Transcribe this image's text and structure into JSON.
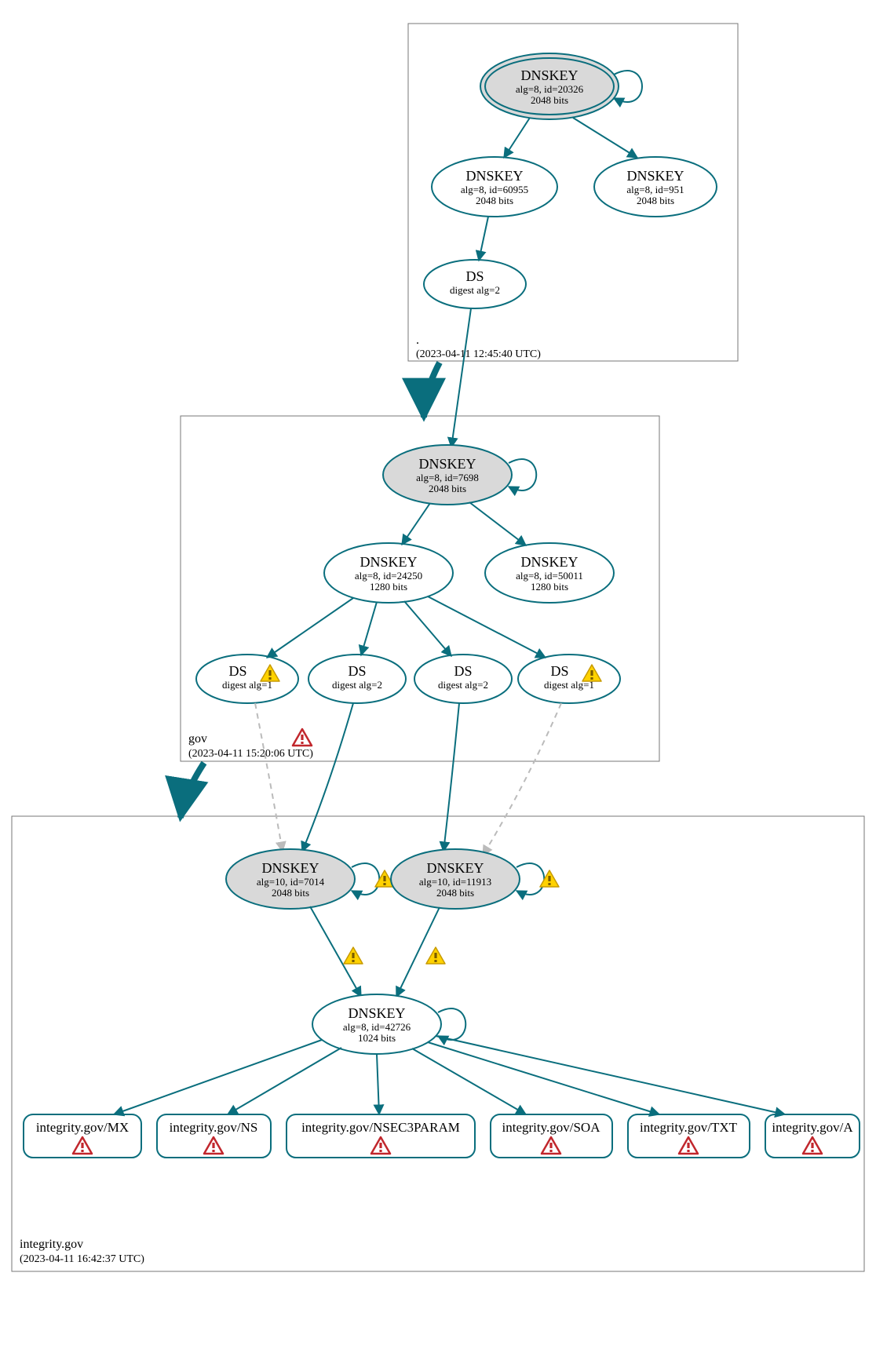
{
  "colors": {
    "stroke": "#0a6e7d",
    "zoneBox": "#777777",
    "keyFill": "#d9d9d9",
    "dashed": "#bbbbbb"
  },
  "zones": {
    "root": {
      "label": ".",
      "timestamp": "(2023-04-11 12:45:40 UTC)"
    },
    "gov": {
      "label": "gov",
      "timestamp": "(2023-04-11 15:20:06 UTC)"
    },
    "integrity": {
      "label": "integrity.gov",
      "timestamp": "(2023-04-11 16:42:37 UTC)"
    }
  },
  "nodes": {
    "root_ksk": {
      "title": "DNSKEY",
      "l1": "alg=8, id=20326",
      "l2": "2048 bits"
    },
    "root_zsk1": {
      "title": "DNSKEY",
      "l1": "alg=8, id=60955",
      "l2": "2048 bits"
    },
    "root_zsk2": {
      "title": "DNSKEY",
      "l1": "alg=8, id=951",
      "l2": "2048 bits"
    },
    "root_ds": {
      "title": "DS",
      "l1": "digest alg=2"
    },
    "gov_ksk": {
      "title": "DNSKEY",
      "l1": "alg=8, id=7698",
      "l2": "2048 bits"
    },
    "gov_zsk1": {
      "title": "DNSKEY",
      "l1": "alg=8, id=24250",
      "l2": "1280 bits"
    },
    "gov_zsk2": {
      "title": "DNSKEY",
      "l1": "alg=8, id=50011",
      "l2": "1280 bits"
    },
    "gov_ds1": {
      "title": "DS",
      "l1": "digest alg=1"
    },
    "gov_ds2": {
      "title": "DS",
      "l1": "digest alg=2"
    },
    "gov_ds3": {
      "title": "DS",
      "l1": "digest alg=2"
    },
    "gov_ds4": {
      "title": "DS",
      "l1": "digest alg=1"
    },
    "int_ksk1": {
      "title": "DNSKEY",
      "l1": "alg=10, id=7014",
      "l2": "2048 bits"
    },
    "int_ksk2": {
      "title": "DNSKEY",
      "l1": "alg=10, id=11913",
      "l2": "2048 bits"
    },
    "int_zsk": {
      "title": "DNSKEY",
      "l1": "alg=8, id=42726",
      "l2": "1024 bits"
    },
    "rr_mx": {
      "label": "integrity.gov/MX"
    },
    "rr_ns": {
      "label": "integrity.gov/NS"
    },
    "rr_nsec3": {
      "label": "integrity.gov/NSEC3PARAM"
    },
    "rr_soa": {
      "label": "integrity.gov/SOA"
    },
    "rr_txt": {
      "label": "integrity.gov/TXT"
    },
    "rr_a": {
      "label": "integrity.gov/A"
    }
  }
}
